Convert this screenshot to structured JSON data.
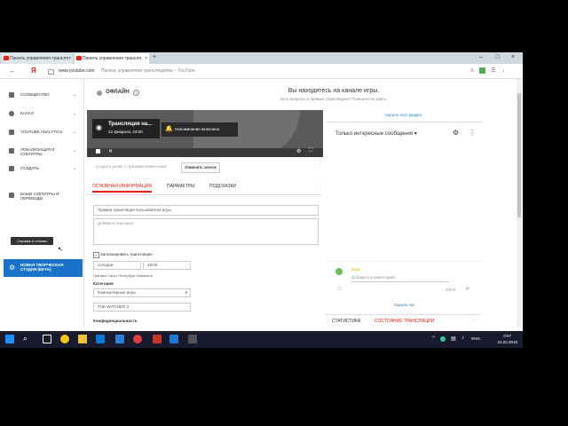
{
  "browser": {
    "tabs": [
      {
        "label": "Панель управления трансля"
      },
      {
        "label": "Панель управления трансля"
      }
    ],
    "close_glyph": "×",
    "yandex_logo": "Я",
    "url_host": "www.youtube.com",
    "url_title": "Панель управления трансляциями – YouTube"
  },
  "sidebar": {
    "items": [
      {
        "label": "СООБЩЕСТВО",
        "icon": "community-icon"
      },
      {
        "label": "КАНАЛ",
        "icon": "channel-icon"
      },
      {
        "label": "YOUTUBE ANALYTICS",
        "icon": "analytics-icon"
      },
      {
        "label": "ЛОКАЛИЗАЦИЯ И СУБТИТРЫ",
        "icon": "translate-icon"
      },
      {
        "label": "СОЗДАТЬ",
        "icon": "create-icon"
      },
      {
        "label": "ВАШИ СУБТИТРЫ И ПЕРЕВОДЫ",
        "icon": "subtitles-icon"
      }
    ],
    "help_tooltip": "Справка и отзывы",
    "studio_beta": "НОВАЯ ТВОРЧЕСКАЯ СТУДИЯ (БЕТА)"
  },
  "main": {
    "offline_label": "ОФЛАЙН",
    "channel_title": "Вы находитесь на канале игры.",
    "channel_sub": "Есть вопросы о прямых трансляциях? Поищите их здесь.",
    "player": {
      "stream_title": "Трансляция на...",
      "stream_date": "22 февраля, 23:00",
      "notify_label": "Напоминание включено"
    },
    "thumb_hint": "Создать ролик с лучшими моментами",
    "change_thumb": "Изменить значок",
    "tabs": [
      "ОСНОВНАЯ ИНФОРМАЦИЯ",
      "ПАРАМЕТРЫ",
      "ПОДСКАЗКИ"
    ],
    "title_field": "Прямая трансляция пользователя игры",
    "description_placeholder": "Добавьте описание",
    "schedule_checkbox": "Запланировать трансляцию",
    "date_value": "Сегодня",
    "time_value": "19:00",
    "timezone": "Гринвич Санкт-Петербург, Изменить",
    "category_label": "Категория",
    "category_value": "Компьютерные игры",
    "game_value": "THE WITCHER 3",
    "privacy_label": "Конфиденциальность"
  },
  "chat": {
    "hide_chat_top": "Скрыть этот раздел",
    "title": "Только интересные сообщения",
    "user_name": "игры",
    "comment_placeholder": "Добавить комментарий...",
    "char_count": "0/200",
    "hide_chat": "Скрыть чат",
    "bottom_tabs": [
      "СТАТИСТИКА",
      "СОСТОЯНИЕ ТРАНСЛЯЦИИ"
    ]
  },
  "taskbar": {
    "lang": "ENG",
    "time": "0:57",
    "date": "22.02.2018"
  },
  "colors": {
    "accent": "#e62117",
    "studio_blue": "#1a73c8",
    "link_blue": "#167ac6"
  }
}
